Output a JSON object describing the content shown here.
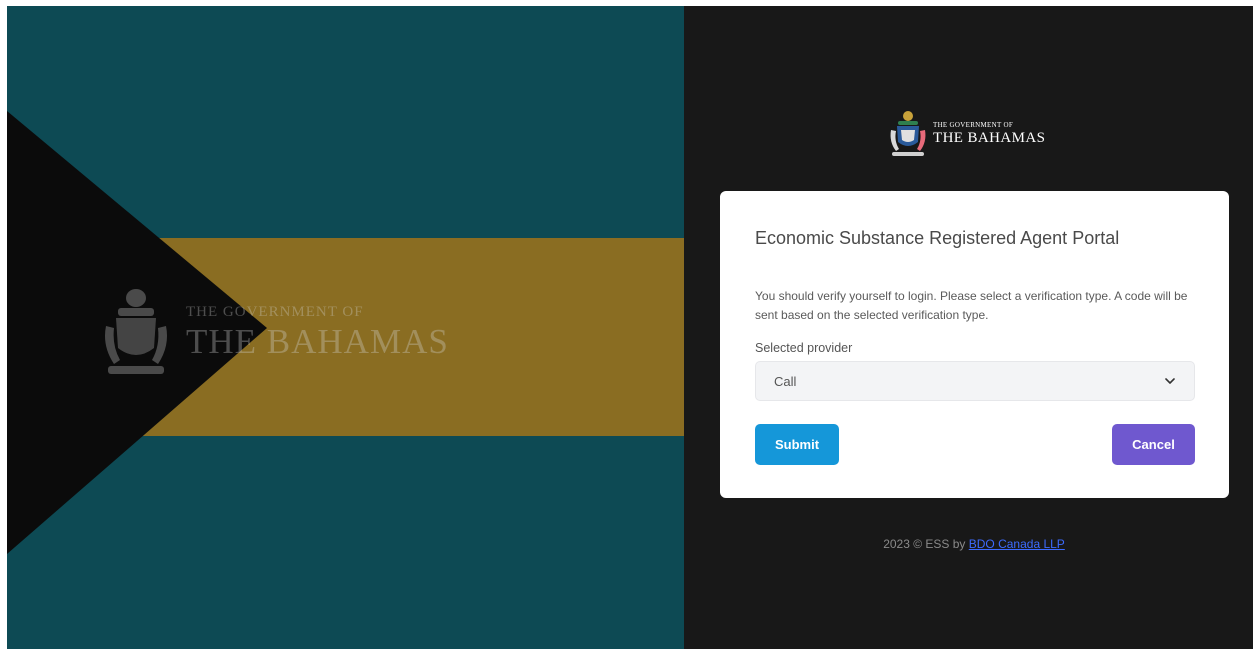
{
  "left_panel": {
    "watermark": {
      "line1": "THE GOVERNMENT OF",
      "line2": "THE BAHAMAS",
      "icon": "coat-of-arms-icon"
    },
    "colors": {
      "aquamarine": "#0d4a54",
      "gold": "#8a6d22",
      "black": "#0b0b0b"
    }
  },
  "logo": {
    "line1": "THE GOVERNMENT OF",
    "line2": "THE BAHAMAS",
    "icon": "coat-of-arms-icon"
  },
  "card": {
    "title": "Economic Substance Registered Agent Portal",
    "message": "You should verify yourself to login. Please select a verification type. A code will be sent based on the selected verification type.",
    "provider_label": "Selected provider",
    "provider_value": "Call",
    "provider_icon": "chevron-down-icon",
    "submit_label": "Submit",
    "cancel_label": "Cancel",
    "colors": {
      "submit": "#1597d9",
      "cancel": "#6f58cf"
    }
  },
  "footer": {
    "prefix": "2023 © ESS by ",
    "link_text": "BDO Canada LLP"
  }
}
